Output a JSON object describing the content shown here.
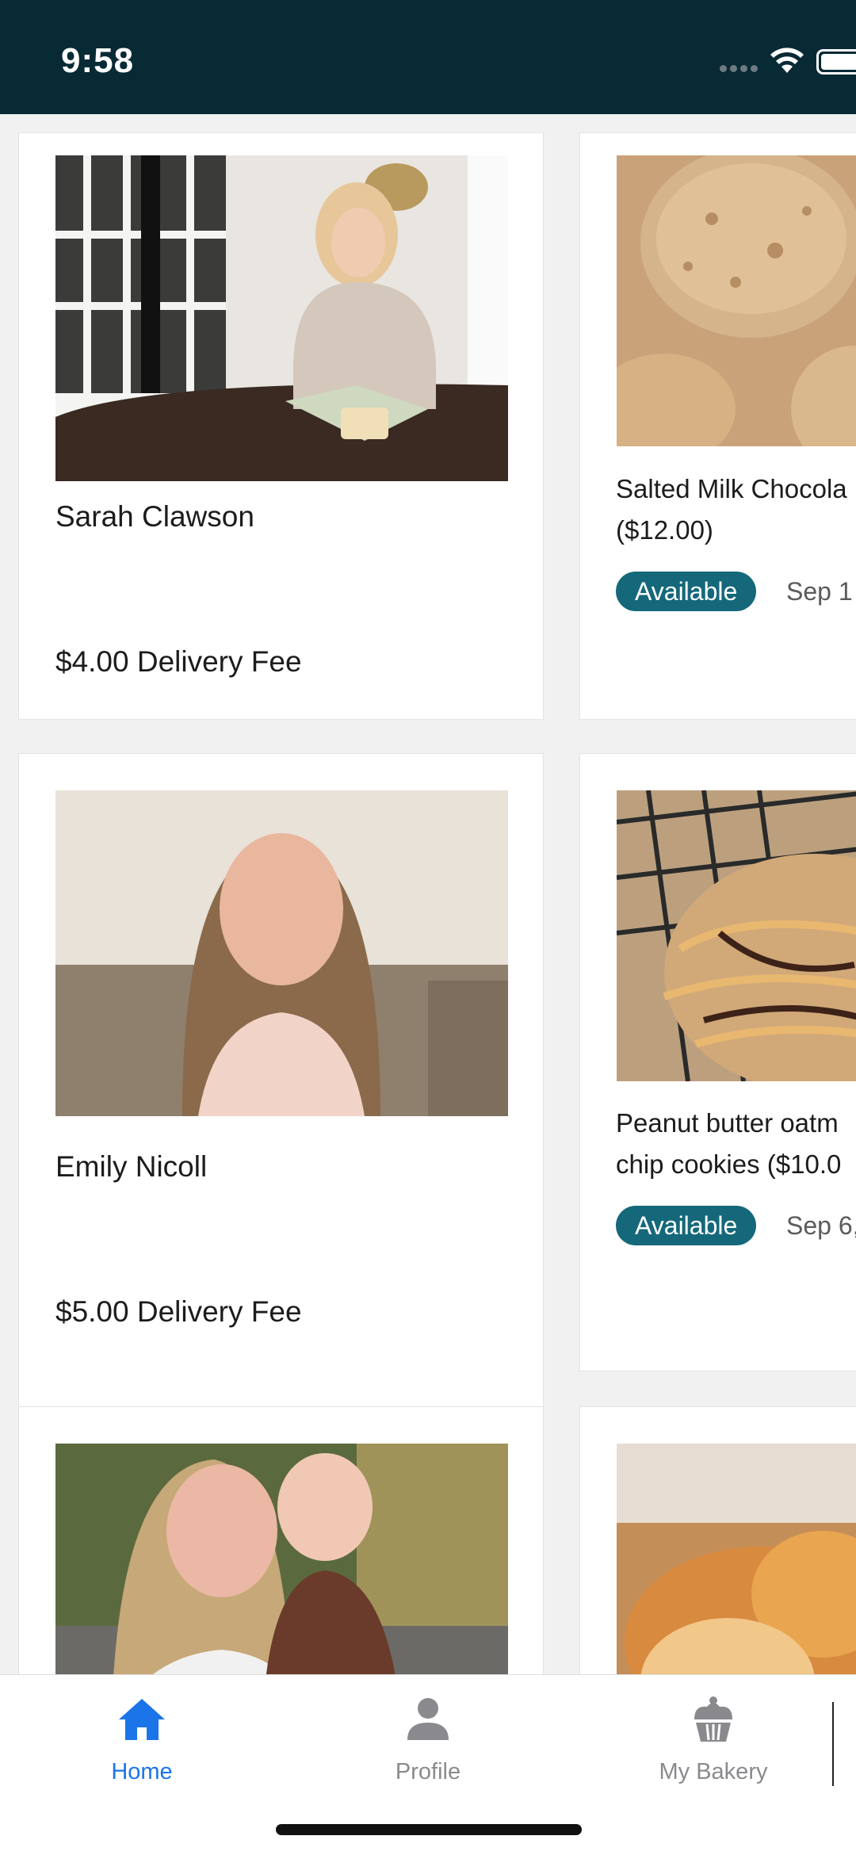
{
  "status_bar": {
    "time": "9:58"
  },
  "bakers": [
    {
      "name": "Sarah Clawson",
      "delivery_fee": "$4.00 Delivery Fee"
    },
    {
      "name": "Emily Nicoll",
      "delivery_fee": "$5.00 Delivery Fee"
    },
    {
      "name": "",
      "delivery_fee": ""
    }
  ],
  "products": [
    {
      "title_line1": "Salted Milk Chocola",
      "title_line2": "($12.00)",
      "status": "Available",
      "date": "Sep 1"
    },
    {
      "title_line1": "Peanut butter oatm",
      "title_line2": "chip cookies  ($10.0",
      "status": "Available",
      "date": "Sep 6,"
    },
    {
      "title_line1": "",
      "title_line2": "",
      "status": "",
      "date": ""
    }
  ],
  "tab_bar": {
    "tabs": [
      {
        "label": "Home",
        "icon": "home-icon",
        "active": true
      },
      {
        "label": "Profile",
        "icon": "person-icon",
        "active": false
      },
      {
        "label": "My Bakery",
        "icon": "cupcake-icon",
        "active": false
      }
    ]
  },
  "colors": {
    "status_bar_bg": "#082a35",
    "badge_bg": "#15687a",
    "active_tab": "#1b74e8",
    "inactive_tab": "#8a8a8e"
  }
}
